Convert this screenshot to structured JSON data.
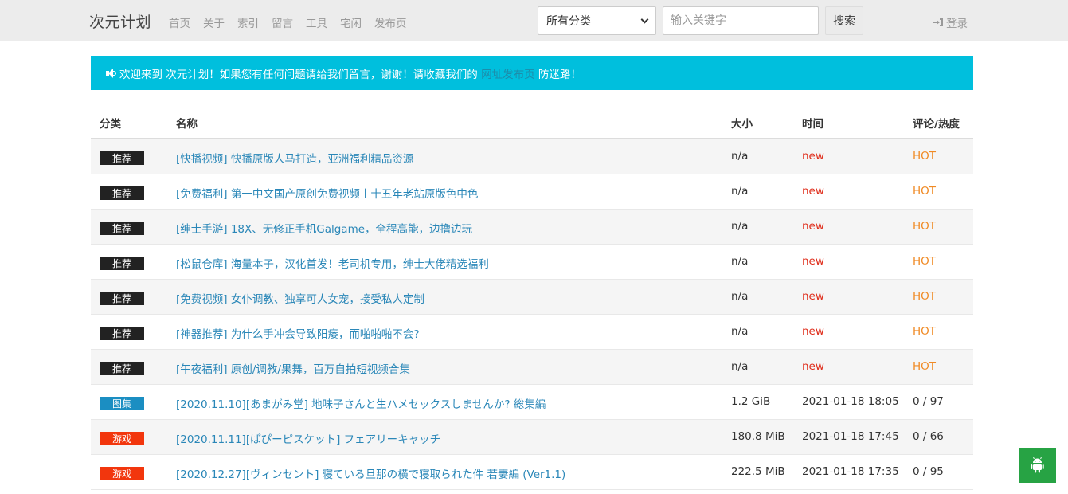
{
  "navbar": {
    "brand": "次元计划",
    "links": [
      "首页",
      "关于",
      "索引",
      "留言",
      "工具",
      "宅闲",
      "发布页"
    ],
    "category_select": {
      "selected": "所有分类"
    },
    "search": {
      "placeholder": "输入关键字",
      "button_label": "搜索"
    },
    "login_label": "登录"
  },
  "notice": {
    "icon": "volume-icon",
    "text_before": "欢迎来到 次元计划！如果您有任何问题请给我们留言，谢谢！请收藏我们的 ",
    "link_text": "网址发布页",
    "text_after": " 防迷路！"
  },
  "table": {
    "headers": [
      "分类",
      "名称",
      "大小",
      "时间",
      "评论/热度"
    ],
    "rows": [
      {
        "badge": "推荐",
        "badge_color": "#222222",
        "name": "[快播视频] 快播原版人马打造，亚洲福利精品资源",
        "size": "n/a",
        "time": "new",
        "hot": "HOT"
      },
      {
        "badge": "推荐",
        "badge_color": "#222222",
        "name": "[免费福利] 第一中文国产原创免费视频丨十五年老站原版色中色",
        "size": "n/a",
        "time": "new",
        "hot": "HOT"
      },
      {
        "badge": "推荐",
        "badge_color": "#222222",
        "name": "[绅士手游] 18X、无修正手机Galgame，全程高能，边撸边玩",
        "size": "n/a",
        "time": "new",
        "hot": "HOT"
      },
      {
        "badge": "推荐",
        "badge_color": "#222222",
        "name": "[松鼠仓库] 海量本子，汉化首发！老司机专用，绅士大佬精选福利",
        "size": "n/a",
        "time": "new",
        "hot": "HOT"
      },
      {
        "badge": "推荐",
        "badge_color": "#222222",
        "name": "[免费视频] 女仆调教、独享可人女宠，接受私人定制",
        "size": "n/a",
        "time": "new",
        "hot": "HOT"
      },
      {
        "badge": "推荐",
        "badge_color": "#222222",
        "name": "[神器推荐] 为什么手冲会导致阳痿，而啪啪啪不会?",
        "size": "n/a",
        "time": "new",
        "hot": "HOT"
      },
      {
        "badge": "推荐",
        "badge_color": "#222222",
        "name": "[午夜福利] 原创/调教/果舞，百万自拍短视频合集",
        "size": "n/a",
        "time": "new",
        "hot": "HOT"
      },
      {
        "badge": "图集",
        "badge_color": "#1b8ec2",
        "name": "[2020.11.10][あまがみ堂] 地味子さんと生ハメセックスしませんか? 総集編",
        "size": "1.2 GiB",
        "time": "2021-01-18 18:05",
        "hot": "0 / 97"
      },
      {
        "badge": "游戏",
        "badge_color": "#f2360d",
        "name": "[2020.11.11][ぱぴーピスケット] フェアリーキャッチ",
        "size": "180.8 MiB",
        "time": "2021-01-18 17:45",
        "hot": "0 / 66"
      },
      {
        "badge": "游戏",
        "badge_color": "#f2360d",
        "name": "[2020.12.27][ヴィンセント] 寝ている旦那の横で寝取られた件 若妻編 (Ver1.1)",
        "size": "222.5 MiB",
        "time": "2021-01-18 17:35",
        "hot": "0 / 95"
      }
    ]
  },
  "colors": {
    "notice_bg": "#00bfdd",
    "link_blue": "#2a87b8",
    "new_red": "#e0301e",
    "hot_orange": "#f08a24",
    "android_green": "#27a344"
  },
  "floating_button": {
    "icon": "android-icon"
  }
}
